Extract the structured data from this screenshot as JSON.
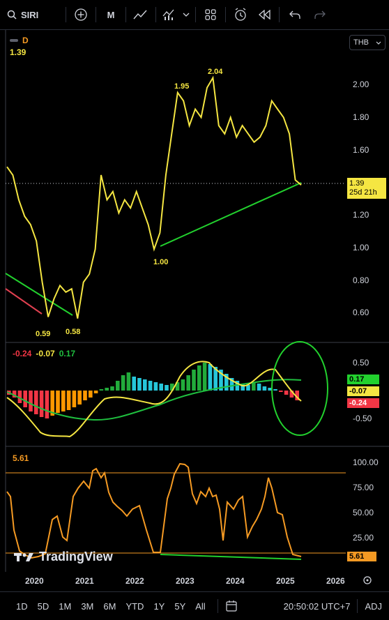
{
  "toolbar": {
    "symbol": "SIRI",
    "interval": "M"
  },
  "header": {
    "last_price": "1.39",
    "currency": "THB",
    "d_badge": "D"
  },
  "price_axis": [
    "2.00",
    "1.80",
    "1.60",
    "1.20",
    "1.00",
    "0.80",
    "0.60"
  ],
  "price_tag": {
    "value": "1.39",
    "countdown": "25d 21h"
  },
  "annotations": [
    "2.04",
    "1.95",
    "1.00",
    "0.59",
    "0.58"
  ],
  "macd": {
    "legend": [
      "-0.24",
      "-0.07",
      "0.17"
    ],
    "axis": [
      "0.50",
      "-0.50"
    ],
    "tags": [
      "0.17",
      "-0.07",
      "-0.24"
    ]
  },
  "rsi": {
    "legend": "5.61",
    "axis": [
      "100.00",
      "75.00",
      "50.00",
      "25.00"
    ],
    "tag": "5.61"
  },
  "watermark": "TradingView",
  "x_axis": [
    "2020",
    "2021",
    "2022",
    "2023",
    "2024",
    "2025",
    "2026"
  ],
  "bottom_bar": {
    "timeframes": [
      "1D",
      "5D",
      "1M",
      "3M",
      "6M",
      "YTD",
      "1Y",
      "5Y",
      "All"
    ],
    "clock": "20:50:02 UTC+7",
    "adj": "ADJ"
  },
  "colors": {
    "price_line": "#f5e642",
    "trendline": "#22d12e",
    "macd_signal": "#1fbf3f",
    "rsi_line": "#f59a23",
    "neg_hist": "#f23645",
    "pos_hist": "#22ab3b"
  },
  "chart_data": {
    "type": "line",
    "series": [
      {
        "values": [
          1.5,
          1.45,
          1.3,
          1.2,
          1.15,
          1.05,
          0.8,
          0.59,
          0.7,
          0.78,
          0.74,
          0.76,
          0.58,
          0.8,
          0.85,
          1.0,
          1.45,
          1.3,
          1.35,
          1.22,
          1.3,
          1.25,
          1.35,
          1.25,
          1.15,
          1.0,
          1.1,
          1.45,
          1.7,
          1.95,
          1.9,
          1.75,
          1.85,
          1.8,
          1.98,
          2.04,
          1.75,
          1.7,
          1.8,
          1.68,
          1.75,
          1.7,
          1.65,
          1.68,
          1.75,
          1.9,
          1.85,
          1.8,
          1.7,
          1.42,
          1.39
        ]
      }
    ],
    "ylim": [
      0.5,
      2.1
    ],
    "xlim": [
      2019.8,
      2026.2
    ]
  }
}
